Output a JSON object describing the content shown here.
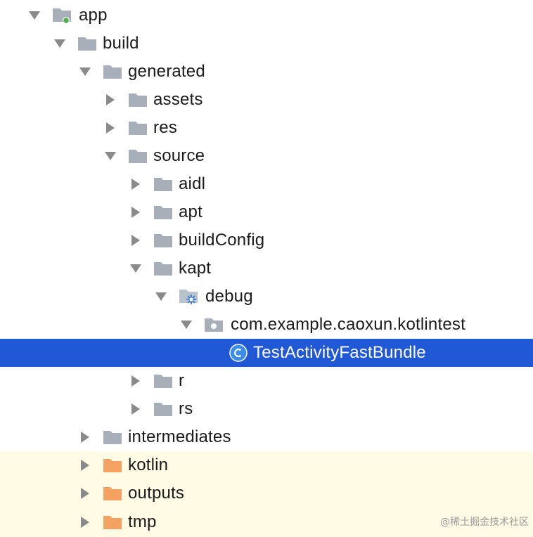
{
  "tree": [
    {
      "label": "app",
      "arrow": "down",
      "icon": "module-icon"
    },
    {
      "label": "build",
      "arrow": "down",
      "icon": "folder-icon"
    },
    {
      "label": "generated",
      "arrow": "down",
      "icon": "folder-icon"
    },
    {
      "label": "assets",
      "arrow": "right",
      "icon": "folder-icon"
    },
    {
      "label": "res",
      "arrow": "right",
      "icon": "folder-icon"
    },
    {
      "label": "source",
      "arrow": "down",
      "icon": "folder-icon"
    },
    {
      "label": "aidl",
      "arrow": "right",
      "icon": "folder-icon"
    },
    {
      "label": "apt",
      "arrow": "right",
      "icon": "folder-icon"
    },
    {
      "label": "buildConfig",
      "arrow": "right",
      "icon": "folder-icon"
    },
    {
      "label": "kapt",
      "arrow": "down",
      "icon": "folder-icon"
    },
    {
      "label": "debug",
      "arrow": "down",
      "icon": "generated-source-folder-icon"
    },
    {
      "label": "com.example.caoxun.kotlintest",
      "arrow": "down",
      "icon": "package-icon"
    },
    {
      "label": "TestActivityFastBundle",
      "arrow": "none",
      "icon": "class-icon",
      "selected": true
    },
    {
      "label": "r",
      "arrow": "right",
      "icon": "folder-icon"
    },
    {
      "label": "rs",
      "arrow": "right",
      "icon": "folder-icon"
    },
    {
      "label": "intermediates",
      "arrow": "right",
      "icon": "folder-icon"
    },
    {
      "label": "kotlin",
      "arrow": "right",
      "icon": "excluded-folder-icon",
      "excluded": true
    },
    {
      "label": "outputs",
      "arrow": "right",
      "icon": "excluded-folder-icon",
      "excluded": true
    },
    {
      "label": "tmp",
      "arrow": "right",
      "icon": "excluded-folder-icon",
      "excluded": true
    }
  ],
  "colors": {
    "selection": "#2158d6",
    "excluded_background": "#fffbe5",
    "folder": "#a8afb8",
    "excluded_folder": "#f4a261",
    "arrow": "#8a8a8a",
    "class_icon": "#3b8ee8"
  },
  "watermark": "@稀土掘金技术社区"
}
